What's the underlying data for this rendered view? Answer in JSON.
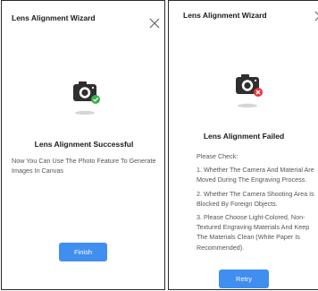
{
  "success_screen": {
    "title": "Lens Alignment Wizard",
    "close_icon": "close-icon",
    "status_icon": "camera-success-icon",
    "heading": "Lens Alignment Successful",
    "description": "Now You Can Use The Photo Feature To Generate Images In Canvas",
    "finish_label": "Finish"
  },
  "failure_screen": {
    "title": "Lens Alignment Wizard",
    "close_icon": "close-icon",
    "status_icon": "camera-error-icon",
    "heading": "Lens Alignment Failed",
    "intro": "Please Check:",
    "checks": [
      "1. Whether The Camera And Material Are Moved During The Engraving Process.",
      "2. Whether The Camera Shooting Area Is Blocked By Foreign Objects.",
      "3. Please Choose Light-Colored, Non-Textured Engraving Materials And Keep The Materials Clean (White Paper Is Recommended)."
    ],
    "retry_label": "Retry"
  },
  "colors": {
    "primary_button": "#3f8ef0",
    "success_badge": "#36b34a",
    "error_badge": "#e8363c",
    "camera_body": "#2f2f2f"
  }
}
